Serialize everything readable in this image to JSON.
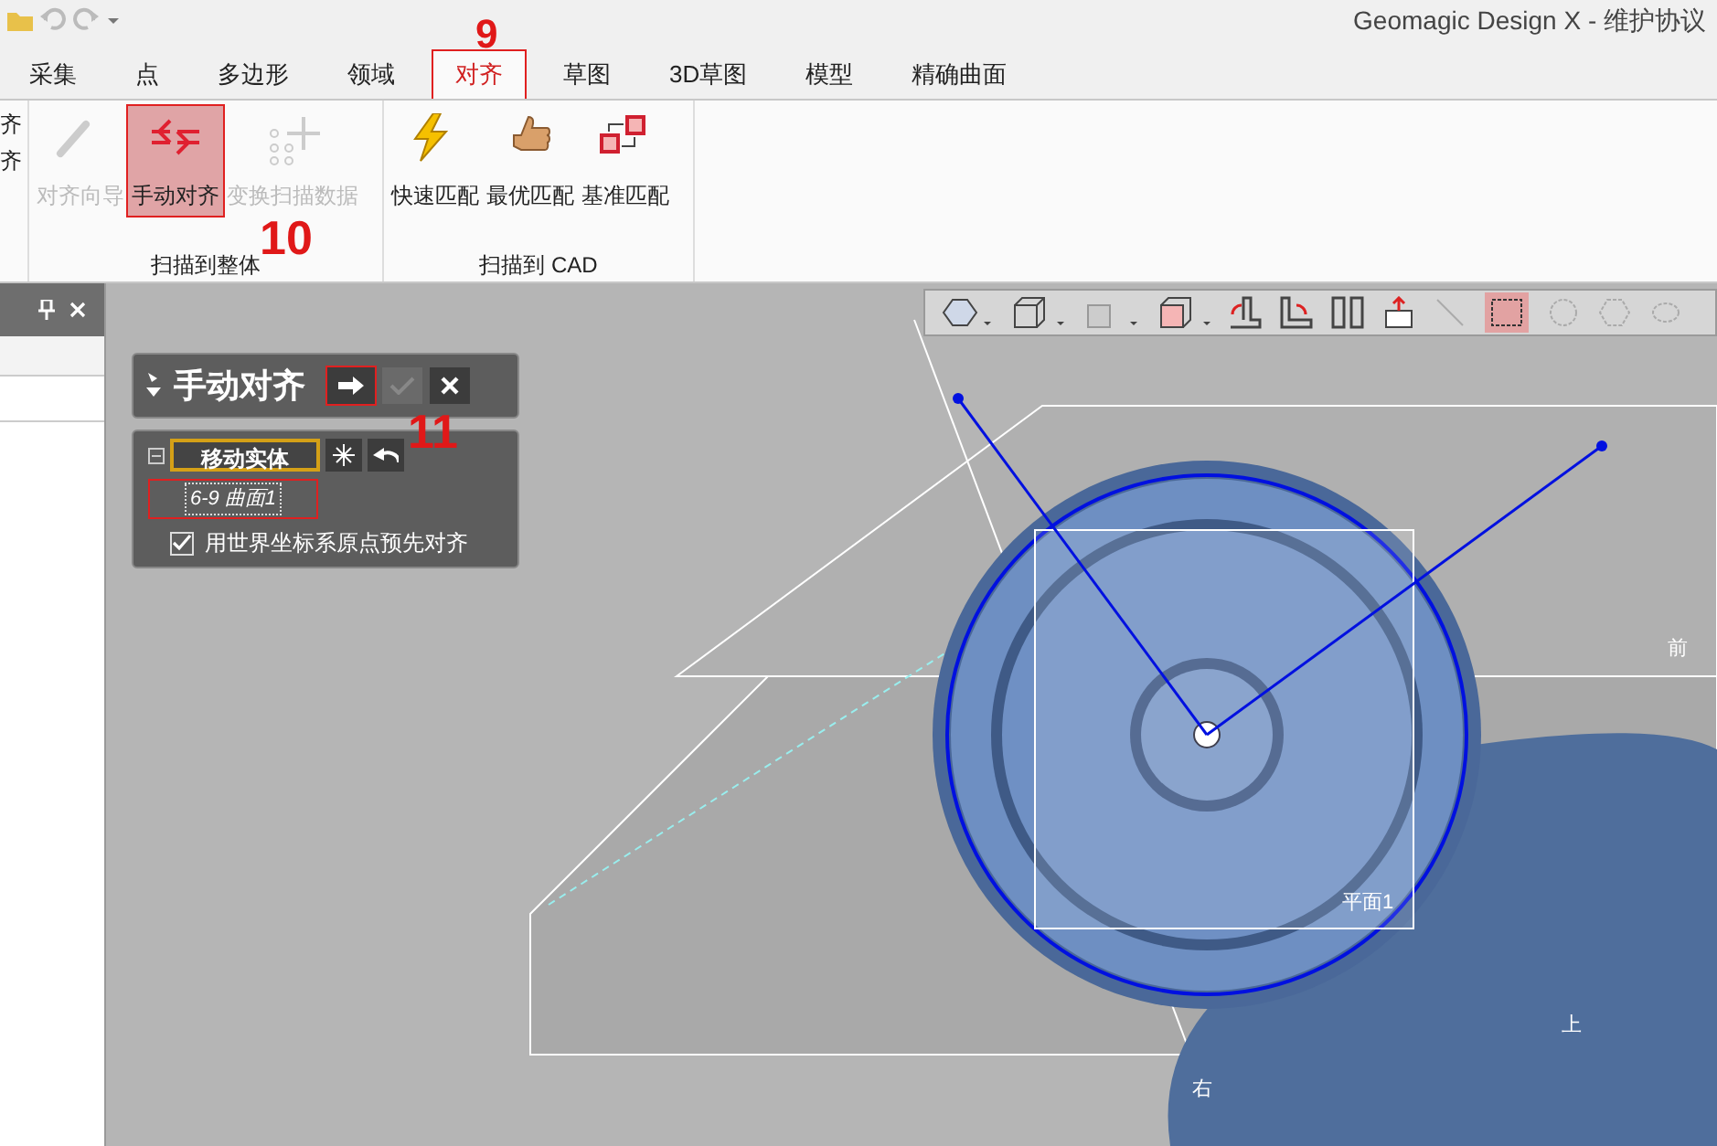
{
  "window": {
    "title": "Geomagic Design X - 维护协议"
  },
  "tabs": [
    {
      "label": "采集",
      "selected": false
    },
    {
      "label": "点",
      "selected": false
    },
    {
      "label": "多边形",
      "selected": false
    },
    {
      "label": "领域",
      "selected": false
    },
    {
      "label": "对齐",
      "selected": true
    },
    {
      "label": "草图",
      "selected": false
    },
    {
      "label": "3D草图",
      "selected": false
    },
    {
      "label": "模型",
      "selected": false
    },
    {
      "label": "精确曲面",
      "selected": false
    }
  ],
  "ribbon": {
    "cut_items": [
      "齐",
      "齐"
    ],
    "groups": [
      {
        "label": "扫描到整体",
        "buttons": [
          {
            "label": "对齐向导",
            "kind": "wand",
            "disabled": true,
            "selected": false
          },
          {
            "label": "手动对齐",
            "kind": "manual",
            "disabled": false,
            "selected": true
          },
          {
            "label": "变换扫描数据",
            "kind": "move",
            "disabled": true,
            "selected": false
          }
        ]
      },
      {
        "label": "扫描到 CAD",
        "buttons": [
          {
            "label": "快速匹配",
            "kind": "bolt",
            "disabled": false,
            "selected": false
          },
          {
            "label": "最优匹配",
            "kind": "thumb",
            "disabled": false,
            "selected": false
          },
          {
            "label": "基准匹配",
            "kind": "datum",
            "disabled": false,
            "selected": false
          }
        ]
      }
    ]
  },
  "callouts": [
    {
      "label": "9",
      "kind": "tab"
    },
    {
      "label": "10",
      "kind": "button"
    },
    {
      "label": "11",
      "kind": "next"
    }
  ],
  "dialog": {
    "title": "手动对齐",
    "ok_disabled": true,
    "section": {
      "label": "移动实体",
      "entity": "6-9 曲面1",
      "checkbox": {
        "label": "用世界坐标系原点预先对齐",
        "checked": true
      }
    }
  },
  "viewport": {
    "labels": [
      {
        "text": "前",
        "kind": "front"
      },
      {
        "text": "平面1",
        "kind": "plane"
      },
      {
        "text": "上",
        "kind": "top"
      },
      {
        "text": "右",
        "kind": "right"
      }
    ]
  }
}
